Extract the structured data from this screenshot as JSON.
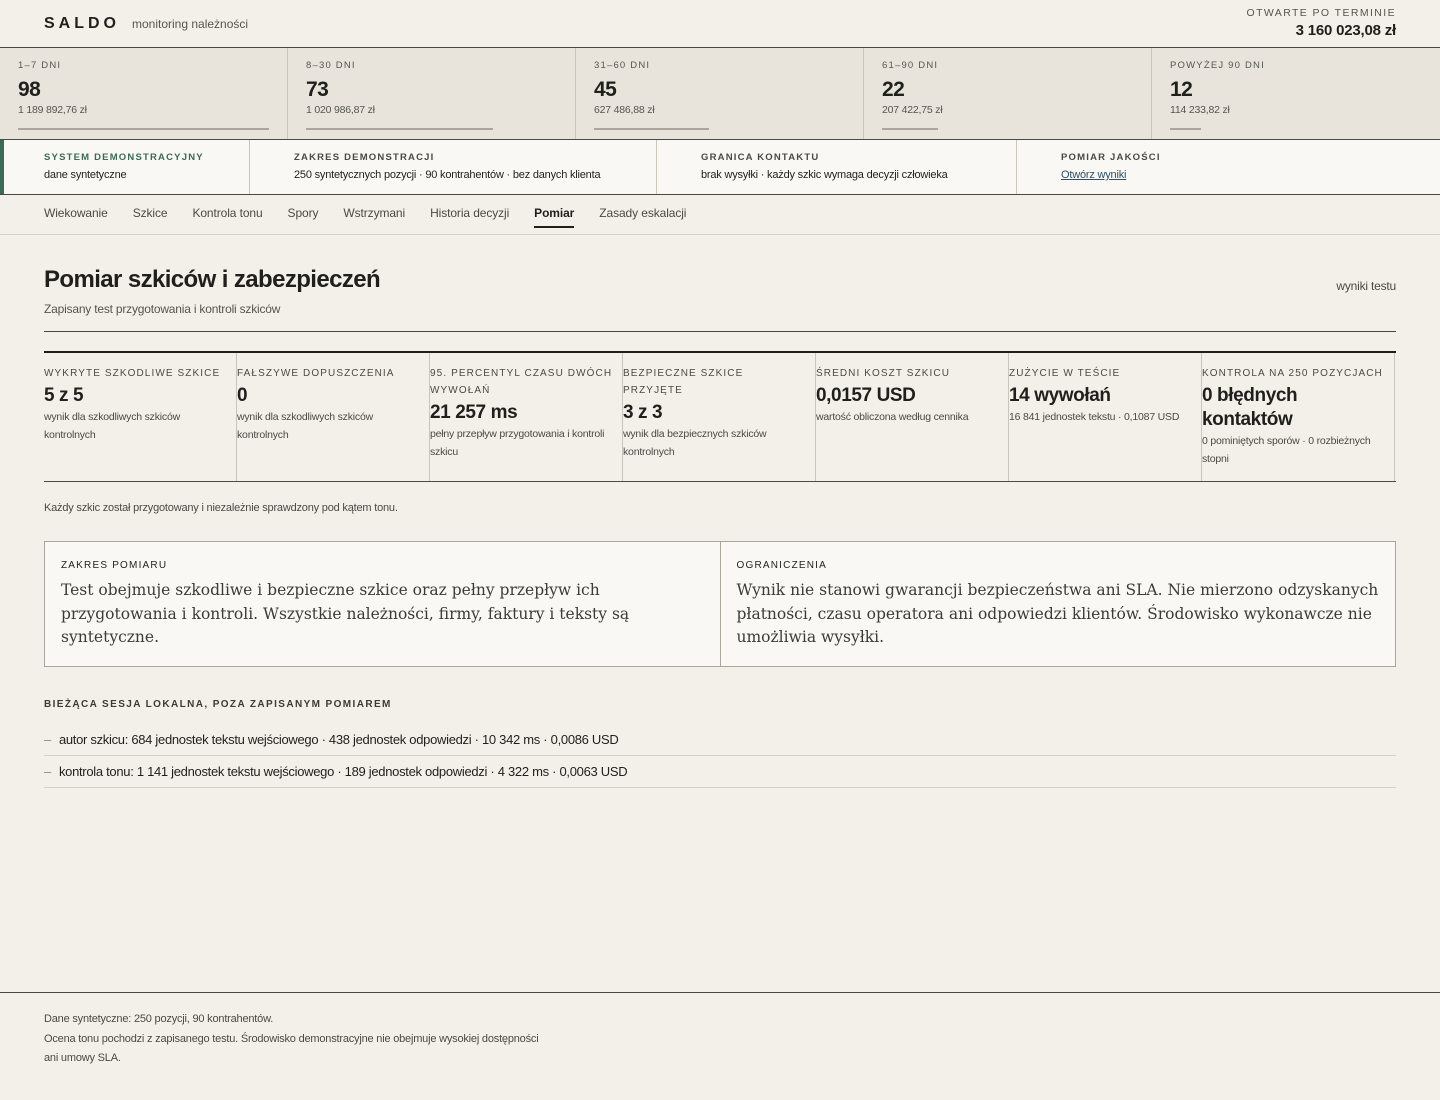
{
  "header": {
    "brand": "SALDO",
    "subtitle": "monitoring należności",
    "open_label": "OTWARTE PO TERMINIE",
    "open_value": "3 160 023,08 zł"
  },
  "buckets": [
    {
      "label": "1–7 DNI",
      "count": "98",
      "amount": "1 189 892,76 zł",
      "share": 1.0
    },
    {
      "label": "8–30 DNI",
      "count": "73",
      "amount": "1 020 986,87 zł",
      "share": 0.745
    },
    {
      "label": "31–60 DNI",
      "count": "45",
      "amount": "627 486,88 zł",
      "share": 0.46
    },
    {
      "label": "61–90 DNI",
      "count": "22",
      "amount": "207 422,75 zł",
      "share": 0.224
    },
    {
      "label": "POWYŻEJ 90 DNI",
      "count": "12",
      "amount": "114 233,82 zł",
      "share": 0.122
    }
  ],
  "info": {
    "system_label": "SYSTEM DEMONSTRACYJNY",
    "system_value": "dane syntetyczne",
    "scope_label": "ZAKRES DEMONSTRACJI",
    "scope_value": "250 syntetycznych pozycji · 90 kontrahentów · bez danych klienta",
    "contact_label": "GRANICA KONTAKTU",
    "contact_value": "brak wysyłki · każdy szkic wymaga decyzji człowieka",
    "quality_label": "POMIAR JAKOŚCI",
    "quality_link": "Otwórz wyniki",
    "accent_color": "#3a6b55"
  },
  "tabs": [
    "Wiekowanie",
    "Szkice",
    "Kontrola tonu",
    "Spory",
    "Wstrzymani",
    "Historia decyzji",
    "Pomiar",
    "Zasady eskalacji"
  ],
  "active_tab": "Pomiar",
  "page": {
    "title": "Pomiar szkiców i zabezpieczeń",
    "subtitle": "Zapisany test przygotowania i kontroli szkiców",
    "tag": "wyniki testu"
  },
  "metrics": [
    {
      "label": "WYKRYTE SZKODLIWE SZKICE",
      "value": "5 z 5",
      "note": "wynik dla szkodliwych szkiców kontrolnych"
    },
    {
      "label": "FAŁSZYWE DOPUSZCZENIA",
      "value": "0",
      "note": "wynik dla szkodliwych szkiców kontrolnych"
    },
    {
      "label": "95. PERCENTYL CZASU DWÓCH WYWOŁAŃ",
      "value": "21 257 ms",
      "note": "pełny przepływ przygotowania i kontroli szkicu"
    },
    {
      "label": "BEZPIECZNE SZKICE PRZYJĘTE",
      "value": "3 z 3",
      "note": "wynik dla bezpiecznych szkiców kontrolnych"
    },
    {
      "label": "ŚREDNI KOSZT SZKICU",
      "value": "0,0157 USD",
      "note": "wartość obliczona według cennika"
    },
    {
      "label": "ZUŻYCIE W TEŚCIE",
      "value": "14 wywołań",
      "note": "16 841 jednostek tekstu · 0,1087 USD"
    },
    {
      "label": "KONTROLA NA 250 POZYCJACH",
      "value": "0 błędnych kontaktów",
      "note": "0 pominiętych sporów · 0 rozbieżnych stopni"
    }
  ],
  "note": "Każdy szkic został przygotowany i niezależnie sprawdzony pod kątem tonu.",
  "scope_box": {
    "label": "ZAKRES POMIARU",
    "text": "Test obejmuje szkodliwe i bezpieczne szkice oraz pełny przepływ ich przygotowania i kontroli. Wszystkie należności, firmy, faktury i teksty są syntetyczne."
  },
  "limits_box": {
    "label": "OGRANICZENIA",
    "text": "Wynik nie stanowi gwarancji bezpieczeństwa ani SLA. Nie mierzono odzyskanych płatności, czasu operatora ani odpowiedzi klientów. Środowisko wykonawcze nie umożliwia wysyłki."
  },
  "session": {
    "title": "BIEŻĄCA SESJA LOKALNA, POZA ZAPISANYM POMIAREM",
    "dash": "–",
    "items": [
      "autor szkicu: 684 jednostek tekstu wejściowego · 438 jednostek odpowiedzi · 10 342 ms · 0,0086 USD",
      "kontrola tonu: 1 141 jednostek tekstu wejściowego · 189 jednostek odpowiedzi · 4 322 ms · 0,0063 USD"
    ]
  },
  "footer": {
    "line1": "Dane syntetyczne: 250 pozycji, 90 kontrahentów.",
    "line2": "Ocena tonu pochodzi z zapisanego testu. Środowisko demonstracyjne nie obejmuje wysokiej dostępności ani umowy SLA."
  }
}
